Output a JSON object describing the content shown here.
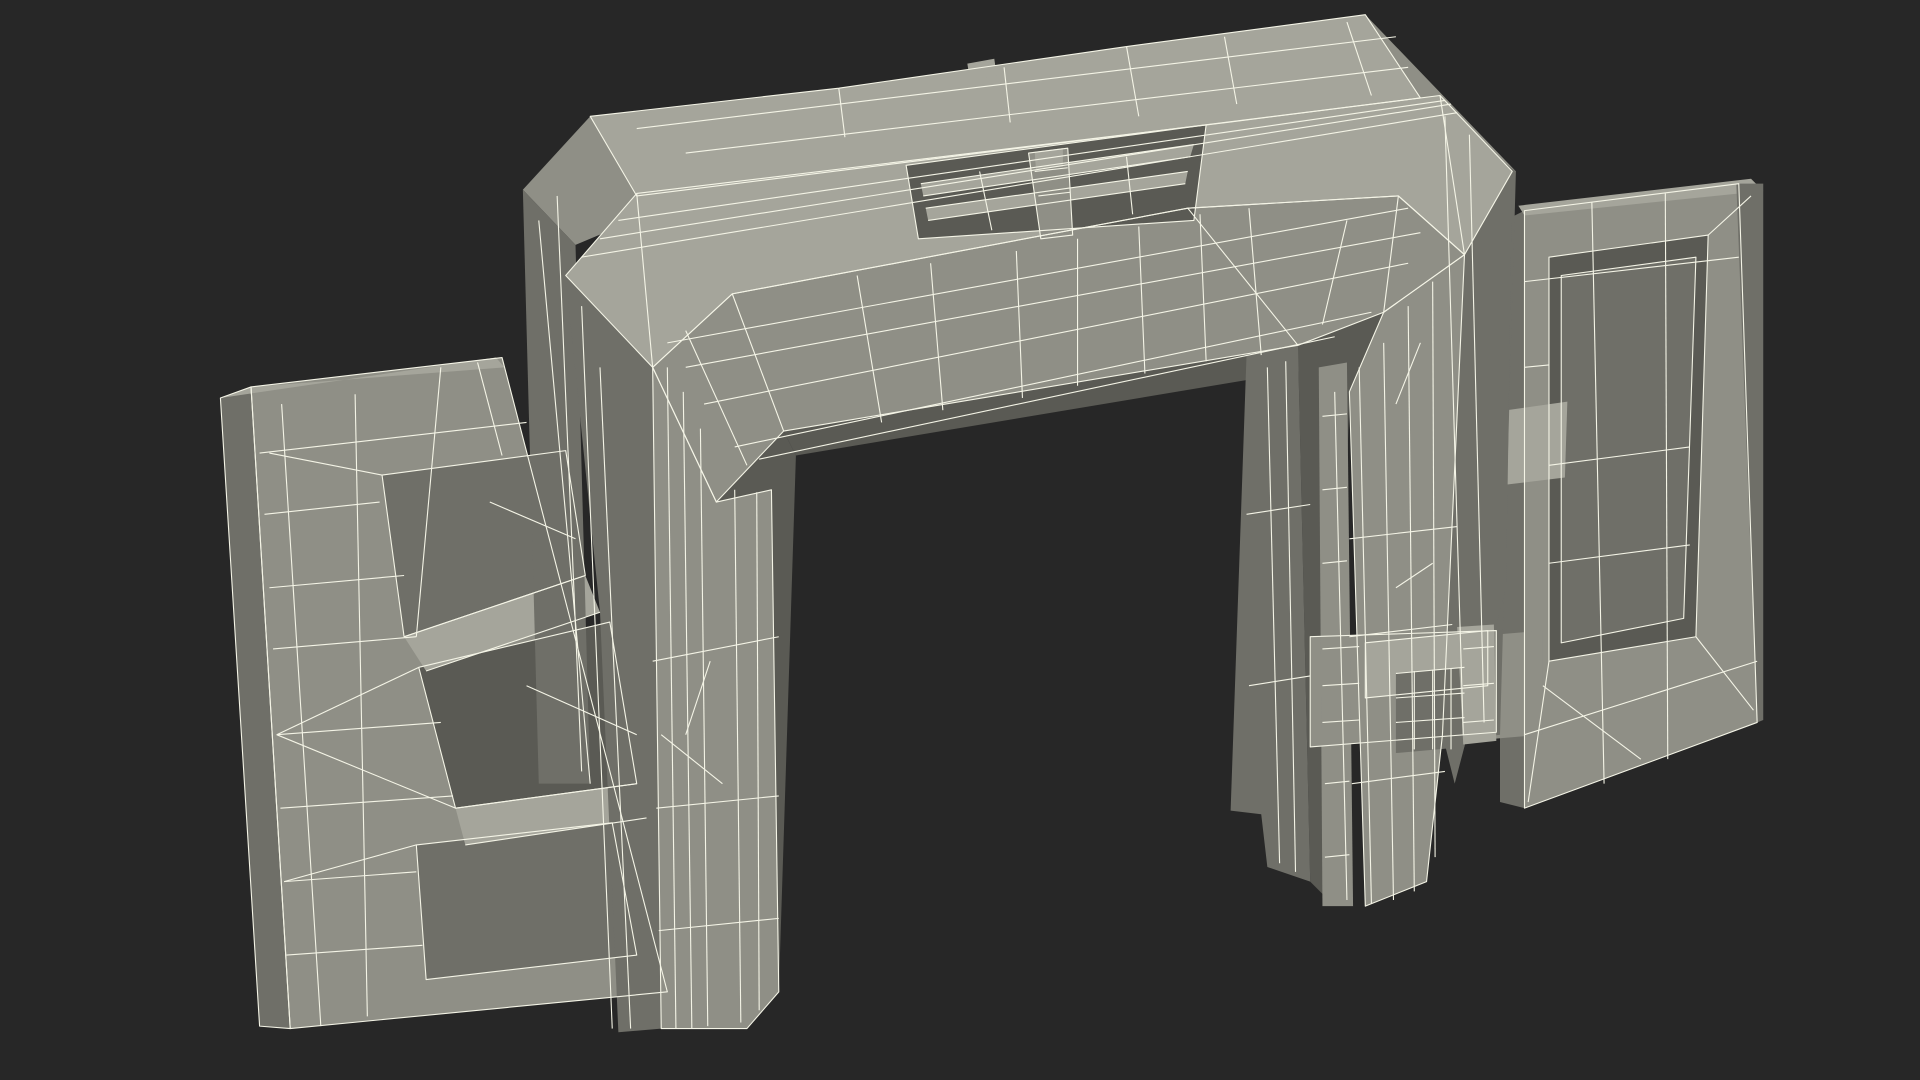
{
  "scene": {
    "subject": "sci-fi-gate-wireframe-render",
    "colors": {
      "background": "#272727",
      "face_light": "#a5a59b",
      "face_mid": "#8f8f86",
      "face_dark": "#6f6f68",
      "face_shadow": "#5a5a54",
      "wire": "#f4f4e6"
    }
  }
}
